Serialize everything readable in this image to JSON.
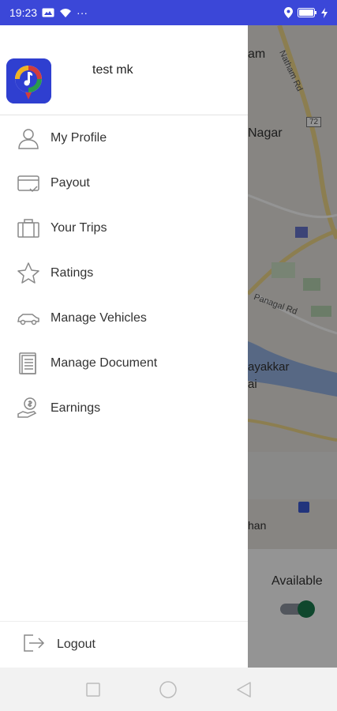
{
  "status_bar": {
    "time": "19:23",
    "dots": "···"
  },
  "drawer": {
    "user_name": "test mk",
    "menu": [
      {
        "label": "My Profile",
        "icon": "user-icon"
      },
      {
        "label": "Payout",
        "icon": "card-icon"
      },
      {
        "label": "Your Trips",
        "icon": "briefcase-icon"
      },
      {
        "label": "Ratings",
        "icon": "star-icon"
      },
      {
        "label": "Manage Vehicles",
        "icon": "car-icon"
      },
      {
        "label": "Manage Document",
        "icon": "document-icon"
      },
      {
        "label": "Earnings",
        "icon": "money-hand-icon"
      }
    ],
    "logout_label": "Logout"
  },
  "map": {
    "labels": [
      "am",
      "Nagar",
      "ayakkar",
      "ai",
      "han"
    ],
    "road_labels": [
      "Natham Rd",
      "Panagal Rd"
    ],
    "route_badge": "72"
  },
  "availability": {
    "label": "Available",
    "on": true
  },
  "colors": {
    "status_bar": "#3b47d8",
    "accent_green": "#1b7a4f",
    "logo_bg": "#2f3fd0"
  }
}
